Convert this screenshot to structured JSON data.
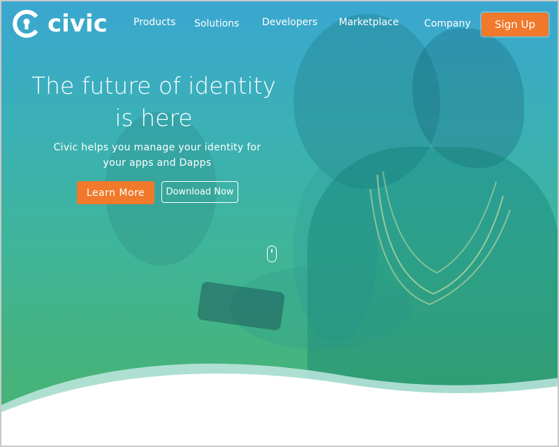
{
  "brand": {
    "name": "civic",
    "accent_color": "#f0792b",
    "gradient_top": "#3aa7d0",
    "gradient_bottom": "#48b276"
  },
  "nav": {
    "items": [
      {
        "label": "Products"
      },
      {
        "label": "Solutions"
      },
      {
        "label": "Developers"
      },
      {
        "label": "Marketplace"
      },
      {
        "label": "Company"
      }
    ],
    "signup_label": "Sign Up"
  },
  "hero": {
    "headline_line1": "The future of identity",
    "headline_line2": "is here",
    "subhead_line1": "Civic helps you manage your identity for",
    "subhead_line2": "your apps and Dapps",
    "primary_cta": "Learn More",
    "secondary_cta": "Download Now",
    "scroll_icon": "mouse-scroll-icon"
  }
}
